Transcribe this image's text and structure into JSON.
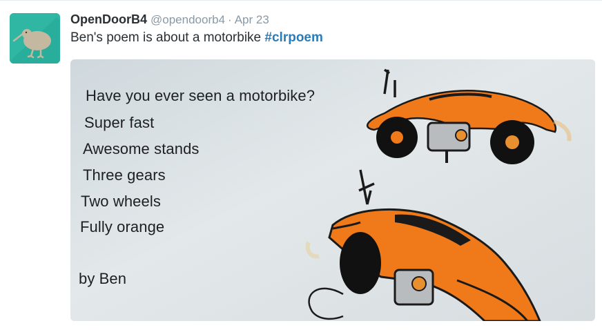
{
  "tweet": {
    "display_name": "OpenDoorB4",
    "handle": "@opendoorb4",
    "separator": "·",
    "timestamp": "Apr 23",
    "text": "Ben's poem is about a motorbike ",
    "hashtag": "#clrpoem"
  },
  "avatar": {
    "icon": "kiwi-bird-icon",
    "background_color": "#2ab3a0"
  },
  "media": {
    "poem_lines": [
      "Have you ever seen a motorbike?",
      "Super fast",
      "Awesome stands",
      "Three gears",
      "Two wheels",
      "Fully orange",
      "by Ben"
    ]
  },
  "colors": {
    "hashtag": "#2b7bb9",
    "meta_gray": "#8899a6",
    "text": "#292f33",
    "drawing_orange": "#f07a1a"
  }
}
